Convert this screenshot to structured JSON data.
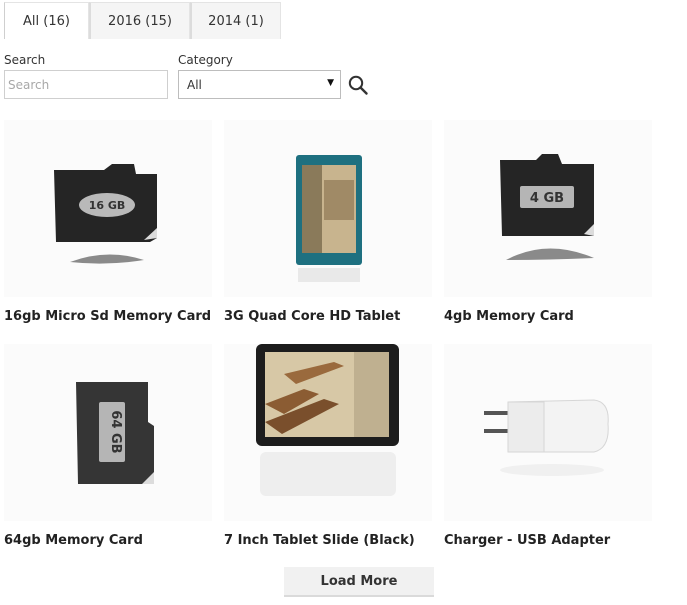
{
  "tabs": [
    {
      "label": "All (16)"
    },
    {
      "label": "2016 (15)"
    },
    {
      "label": "2014 (1)"
    }
  ],
  "filters": {
    "search_label": "Search",
    "search_placeholder": "Search",
    "category_label": "Category",
    "category_value": "All"
  },
  "products": [
    {
      "title": "16gb Micro Sd Memory Card",
      "card_text": "16 GB"
    },
    {
      "title": "3G Quad Core HD Tablet"
    },
    {
      "title": "4gb Memory Card",
      "card_text": "4 GB"
    },
    {
      "title": "64gb Memory Card",
      "card_text": "64 GB"
    },
    {
      "title": "7 Inch Tablet Slide (Black)"
    },
    {
      "title": "Charger - USB Adapter"
    }
  ],
  "load_more_label": "Load More"
}
